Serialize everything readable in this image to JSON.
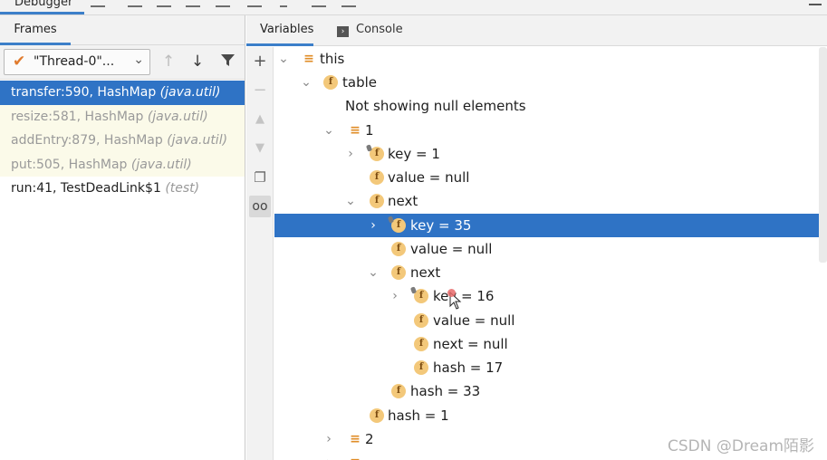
{
  "toolbar": {
    "debugger_tab": "Debugger"
  },
  "frames_panel": {
    "tab_label": "Frames",
    "thread_select": "\"Thread-0\"...",
    "frames": [
      {
        "method": "transfer:590, HashMap",
        "pkg": "(java.util)"
      },
      {
        "method": "resize:581, HashMap",
        "pkg": "(java.util)"
      },
      {
        "method": "addEntry:879, HashMap",
        "pkg": "(java.util)"
      },
      {
        "method": "put:505, HashMap",
        "pkg": "(java.util)"
      },
      {
        "method": "run:41, TestDeadLink$1",
        "pkg": "(test)"
      }
    ]
  },
  "variables_panel": {
    "tab_variables": "Variables",
    "tab_console": "Console",
    "tree": [
      {
        "label": "this"
      },
      {
        "label": "table"
      },
      {
        "label": "Not showing null elements"
      },
      {
        "label": "1"
      },
      {
        "label": "key = 1"
      },
      {
        "label": "value = null"
      },
      {
        "label": "next"
      },
      {
        "label": "key = 35"
      },
      {
        "label": "value = null"
      },
      {
        "label": "next"
      },
      {
        "label": "key = 16"
      },
      {
        "label": "value = null"
      },
      {
        "label": "next = null"
      },
      {
        "label": "hash = 17"
      },
      {
        "label": "hash = 33"
      },
      {
        "label": "hash = 1"
      },
      {
        "label": "2"
      }
    ]
  },
  "watermark": "CSDN @Dream陌影",
  "colors": {
    "selection": "#2f73c5",
    "accent": "#3c7fc9",
    "library_frame_bg": "#fbfae9",
    "field_icon": "#f3c87a"
  }
}
